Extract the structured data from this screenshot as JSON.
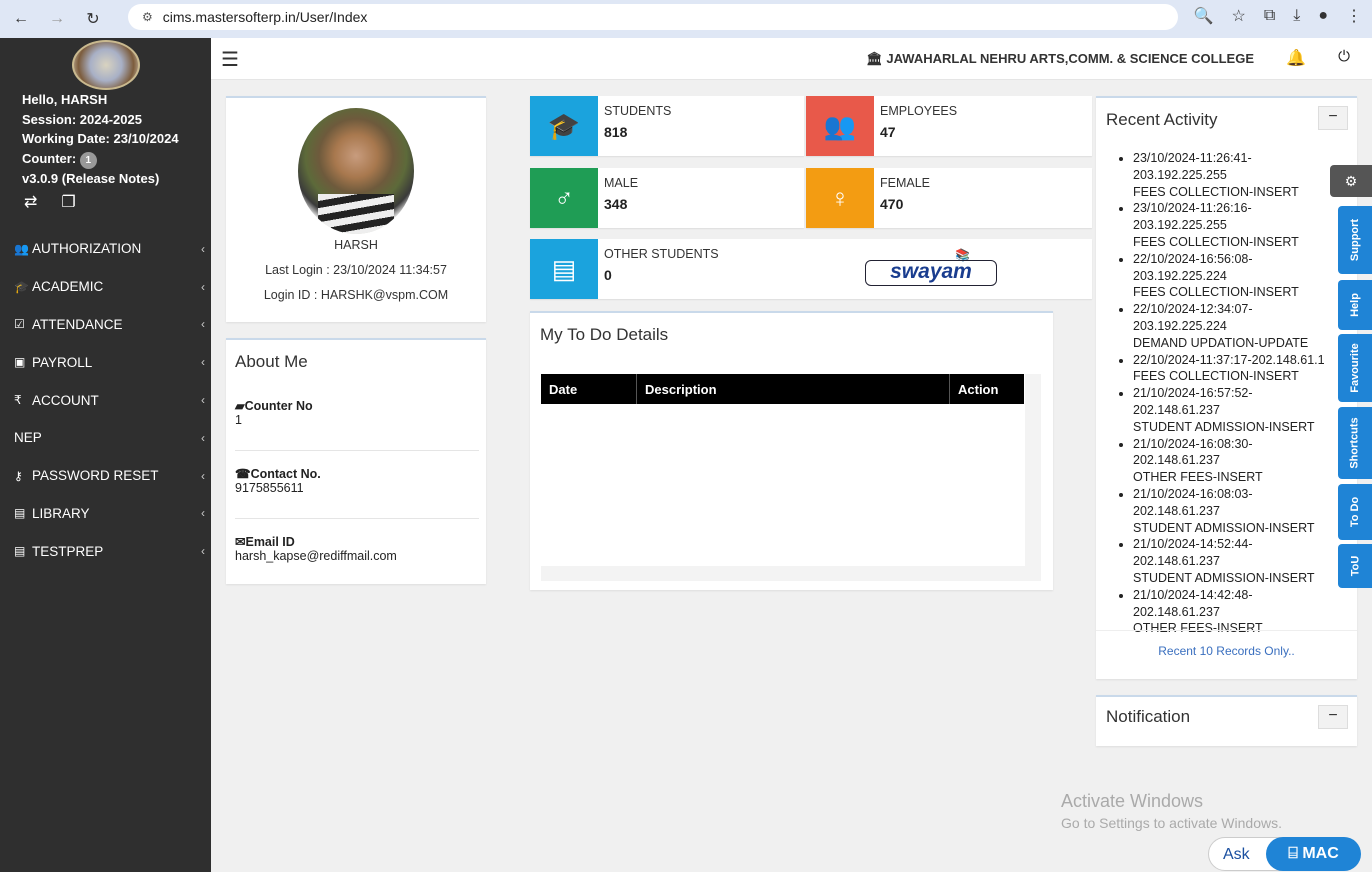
{
  "browser": {
    "url": "cims.mastersofterp.in/User/Index"
  },
  "user": {
    "greeting": "Hello, HARSH",
    "session": "Session: 2024-2025",
    "working_date": "Working Date: 23/10/2024",
    "counter_label": "Counter:",
    "counter_badge": "1",
    "version": "v3.0.9 (Release Notes)"
  },
  "menu": [
    {
      "label": "AUTHORIZATION",
      "icon": "users-icon"
    },
    {
      "label": "ACADEMIC",
      "icon": "graduation-cap-icon"
    },
    {
      "label": "ATTENDANCE",
      "icon": "check-square-icon"
    },
    {
      "label": "PAYROLL",
      "icon": "money-icon"
    },
    {
      "label": "ACCOUNT",
      "icon": "rupee-icon"
    },
    {
      "label": "NEP",
      "icon": ""
    },
    {
      "label": "PASSWORD RESET",
      "icon": "key-icon"
    },
    {
      "label": "LIBRARY",
      "icon": "book-icon"
    },
    {
      "label": "TESTPREP",
      "icon": "book-icon"
    }
  ],
  "header": {
    "college": "JAWAHARLAL NEHRU ARTS,COMM. & SCIENCE COLLEGE"
  },
  "profile": {
    "name": "HARSH",
    "last_login": "Last Login : 23/10/2024 11:34:57",
    "login_id": "Login ID : HARSHK@vspm.COM"
  },
  "about": {
    "title": "About Me",
    "counter_label": "Counter No",
    "counter_value": "1",
    "contact_label": "Contact No.",
    "contact_value": "9175855611",
    "email_label": "Email ID",
    "email_value": "harsh_kapse@rediffmail.com"
  },
  "stats": {
    "students": {
      "label": "STUDENTS",
      "value": "818",
      "color": "#1ba3dd"
    },
    "employees": {
      "label": "EMPLOYEES",
      "value": "47",
      "color": "#e8594a"
    },
    "male": {
      "label": "MALE",
      "value": "348",
      "color": "#1f9d55"
    },
    "female": {
      "label": "FEMALE",
      "value": "470",
      "color": "#f39c12"
    },
    "other": {
      "label": "OTHER STUDENTS",
      "value": "0",
      "color": "#1ba3dd"
    }
  },
  "swayam": {
    "logo_text": "swayam"
  },
  "todo": {
    "title": "My To Do Details",
    "columns": [
      "Date",
      "Description",
      "Action"
    ]
  },
  "activity": {
    "title": "Recent Activity",
    "items": [
      [
        "23/10/2024-11:26:41-",
        "203.192.225.255",
        "FEES COLLECTION-INSERT"
      ],
      [
        "23/10/2024-11:26:16-",
        "203.192.225.255",
        "FEES COLLECTION-INSERT"
      ],
      [
        "22/10/2024-16:56:08-",
        "203.192.225.224",
        "FEES COLLECTION-INSERT"
      ],
      [
        "22/10/2024-12:34:07-",
        "203.192.225.224",
        "DEMAND UPDATION-UPDATE"
      ],
      [
        "22/10/2024-11:37:17-202.148.61.1",
        "FEES COLLECTION-INSERT"
      ],
      [
        "21/10/2024-16:57:52-",
        "202.148.61.237",
        "STUDENT ADMISSION-INSERT"
      ],
      [
        "21/10/2024-16:08:30-",
        "202.148.61.237",
        "OTHER FEES-INSERT"
      ],
      [
        "21/10/2024-16:08:03-",
        "202.148.61.237",
        "STUDENT ADMISSION-INSERT"
      ],
      [
        "21/10/2024-14:52:44-",
        "202.148.61.237",
        "STUDENT ADMISSION-INSERT"
      ],
      [
        "21/10/2024-14:42:48-",
        "202.148.61.237",
        "OTHER FEES-INSERT"
      ]
    ],
    "footer": "Recent 10 Records Only.."
  },
  "notification": {
    "title": "Notification"
  },
  "side_tabs": [
    "Support",
    "Help",
    "Favourite",
    "Shortcuts",
    "To Do",
    "ToU"
  ],
  "watermark": {
    "line1": "Activate Windows",
    "line2": "Go to Settings to activate Windows."
  },
  "ask": {
    "label": "Ask",
    "brand": "MAC"
  },
  "collapse_symbol": "−"
}
